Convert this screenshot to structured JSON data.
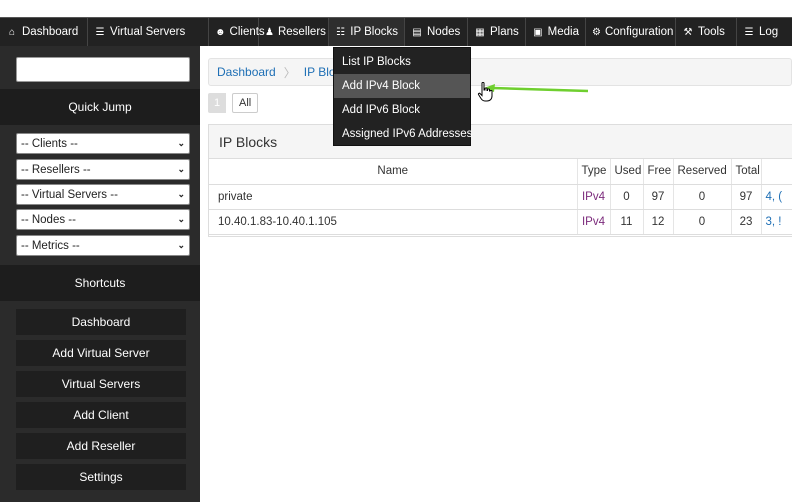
{
  "nav": {
    "items": [
      {
        "label": "Dashboard",
        "icon": "home-icon",
        "glyph": "⌂"
      },
      {
        "label": "Virtual Servers",
        "icon": "list-icon",
        "glyph": "☰"
      },
      {
        "label": "Clients",
        "icon": "users-icon",
        "glyph": "☻"
      },
      {
        "label": "Resellers",
        "icon": "user-icon",
        "glyph": "♟"
      },
      {
        "label": "IP Blocks",
        "icon": "grid-icon",
        "glyph": "☷"
      },
      {
        "label": "Nodes",
        "icon": "server-icon",
        "glyph": "▤"
      },
      {
        "label": "Plans",
        "icon": "table-icon",
        "glyph": "▦"
      },
      {
        "label": "Media",
        "icon": "media-icon",
        "glyph": "▣"
      },
      {
        "label": "Configuration",
        "icon": "gear-icon",
        "glyph": "⚙"
      },
      {
        "label": "Tools",
        "icon": "wrench-icon",
        "glyph": "⚒"
      },
      {
        "label": "Log",
        "icon": "log-icon",
        "glyph": "☰"
      }
    ]
  },
  "sidebar": {
    "search_value": "",
    "quick_jump": "Quick Jump",
    "selects": [
      "-- Clients --",
      "-- Resellers --",
      "-- Virtual Servers --",
      "-- Nodes --",
      "-- Metrics --"
    ],
    "shortcuts_header": "Shortcuts",
    "shortcuts": [
      "Dashboard",
      "Add Virtual Server",
      "Virtual Servers",
      "Add Client",
      "Add Reseller",
      "Settings"
    ]
  },
  "breadcrumb": {
    "home": "Dashboard",
    "current": "IP Block"
  },
  "pager": {
    "page": "1",
    "all": "All"
  },
  "panel": {
    "title": "IP Blocks",
    "columns": [
      "Name",
      "Type",
      "Used",
      "Free",
      "Reserved",
      "Total",
      ""
    ],
    "rows": [
      {
        "name": "private",
        "type": "IPv4",
        "used": "0",
        "free": "97",
        "reserved": "0",
        "total": "97",
        "actions": "4, ("
      },
      {
        "name": "10.40.1.83-10.40.1.105",
        "type": "IPv4",
        "used": "11",
        "free": "12",
        "reserved": "0",
        "total": "23",
        "actions": "3, !"
      }
    ]
  },
  "dropdown": {
    "items": [
      "List IP Blocks",
      "Add IPv4 Block",
      "Add IPv6 Block",
      "Assigned IPv6 Addresses"
    ],
    "highlighted_index": 1
  },
  "colors": {
    "nav_bg": "#222222",
    "sidebar_bg": "#2b2b2b",
    "link": "#1e6fb5",
    "type": "#7b2a7b",
    "arrow": "#6fcf2f"
  }
}
